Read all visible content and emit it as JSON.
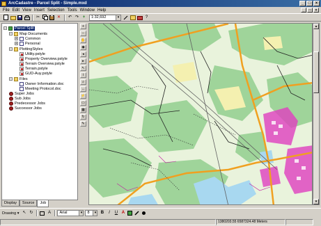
{
  "window": {
    "title": "ArcCadastre - Parcel Split - Simple.mxd",
    "minimize": "_",
    "maximize": "□",
    "close": "×"
  },
  "menu": [
    "File",
    "Edit",
    "View",
    "Insert",
    "Selection",
    "Tools",
    "Window",
    "Help"
  ],
  "toolbar": {
    "scale_value": "1:32,692"
  },
  "tree": {
    "root": "Parcel Split",
    "map_documents": "Map Documents",
    "common": "Common",
    "personal": "Personal",
    "plotting_styles": "PlottingStyles",
    "utility": "Utility.pstyle",
    "property_overview": "Property Overview.pstyle",
    "terrain_overview": "Terrain Overview.pstyle",
    "terrain": "Terrain.pstyle",
    "gud_auy": "GUD-Auy.pstyle",
    "files": "Files",
    "owner_information": "Owner Information.doc",
    "meeting_protocol": "Meeting Protocol.doc",
    "super_jobs": "Super Jobs",
    "sub_jobs": "Sub Jobs",
    "predecessor_jobs": "Predecessor Jobs",
    "successor_jobs": "Successor Jobs"
  },
  "tabs": [
    "Display",
    "Source",
    "Job"
  ],
  "drawing": {
    "label": "Drawing ▾",
    "font": "Arial",
    "size": "8",
    "bold": "B",
    "italic": "I",
    "underline": "U"
  },
  "status": {
    "coordinates": "1380203.55  6587324.48 Meters"
  },
  "colors": {
    "title_bar": "#0a246a",
    "map_background": "#e9f3dc",
    "forest": "#9fd49a",
    "highway": "#f0a020",
    "water": "#a8d8f0",
    "urban": "#e040c0"
  },
  "icons": {
    "vertical_tools": [
      "zoom-in-icon",
      "zoom-out-icon",
      "pan-icon",
      "full-extent-icon",
      "back-icon",
      "forward-icon",
      "select-icon",
      "identify-icon",
      "find-icon",
      "measure-icon",
      "hyperlink-icon"
    ]
  }
}
